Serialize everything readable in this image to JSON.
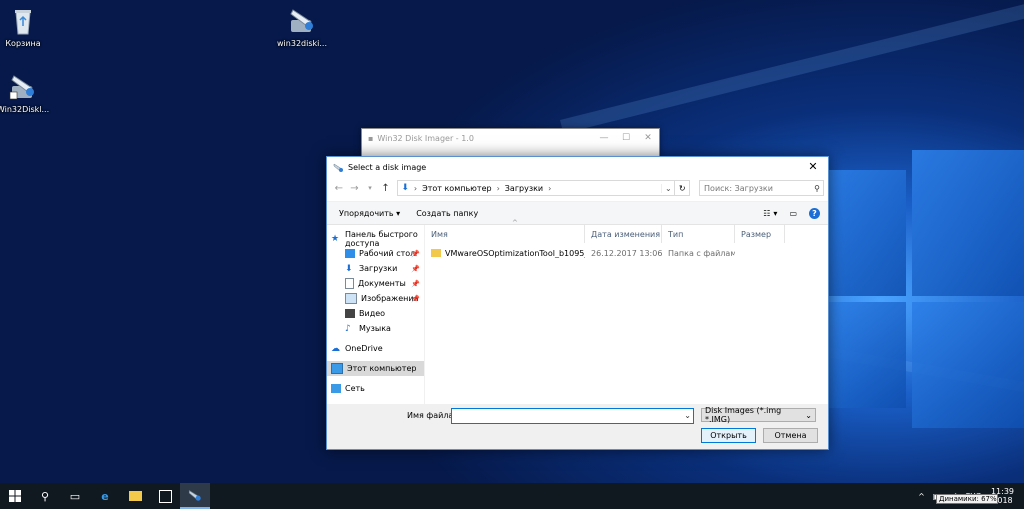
{
  "desktop": {
    "icons": [
      {
        "label": "Корзина"
      },
      {
        "label": "win32diski..."
      },
      {
        "label": "Win32Diskl..."
      }
    ]
  },
  "back_window": {
    "title": "Win32 Disk Imager - 1.0"
  },
  "dialog": {
    "title": "Select a disk image",
    "breadcrumb": [
      "Этот компьютер",
      "Загрузки"
    ],
    "search_placeholder": "Поиск: Загрузки",
    "toolbar": {
      "organize": "Упорядочить ▾",
      "new_folder": "Создать папку"
    },
    "nav": {
      "quick_access": "Панель быстрого доступа",
      "items": [
        {
          "label": "Рабочий стол"
        },
        {
          "label": "Загрузки"
        },
        {
          "label": "Документы"
        },
        {
          "label": "Изображения"
        },
        {
          "label": "Видео"
        },
        {
          "label": "Музыка"
        }
      ],
      "onedrive": "OneDrive",
      "this_pc": "Этот компьютер",
      "network": "Сеть"
    },
    "columns": [
      "Имя",
      "Дата изменения",
      "Тип",
      "Размер"
    ],
    "files": [
      {
        "name": "VMwareOSOptimizationTool_b1095_7348...",
        "date": "26.12.2017 13:06",
        "type": "Папка с файлами",
        "size": ""
      }
    ],
    "filename_label": "Имя файла:",
    "filename_value": "",
    "filetype": "Disk Images (*.img *.IMG)",
    "open_label": "Открыть",
    "cancel_label": "Отмена"
  },
  "taskbar": {
    "lang": "РУС",
    "time": "11:39",
    "date": "2018",
    "tooltip": "Динамики: 67%"
  },
  "colors": {
    "accent": "#0078d7",
    "taskbar": "#101820",
    "selection": "#d9d9d9"
  }
}
